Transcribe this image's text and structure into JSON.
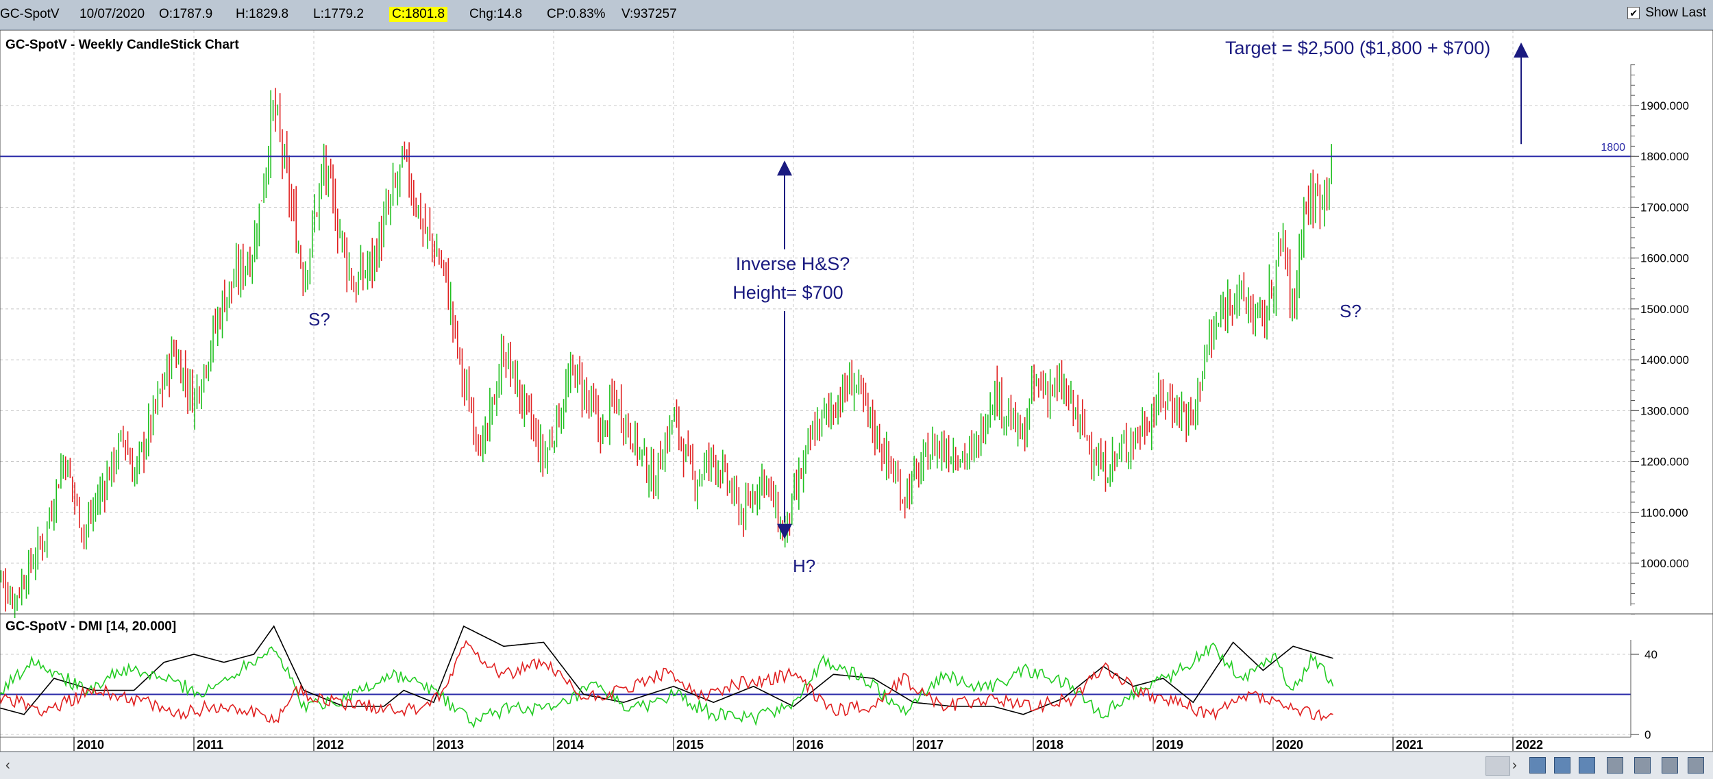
{
  "toolbar": {
    "symbol": "GC-SpotV",
    "date": "10/07/2020",
    "open": "O:1787.9",
    "high": "H:1829.8",
    "low": "L:1779.2",
    "close": "C:1801.8",
    "change": "Chg:14.8",
    "change_pct": "CP:0.83%",
    "volume": "V:937257",
    "show_last_label": "Show Last",
    "show_last_checked": "✔"
  },
  "colors": {
    "up": "#20c020",
    "down": "#e02020",
    "annotation": "#1a1a80",
    "grid": "#c8c8c8",
    "adx": "#000000",
    "plus_di": "#22cc22",
    "minus_di": "#e02020",
    "threshold": "#2a2aa8"
  },
  "chart_data": [
    {
      "type": "candlestick",
      "title": "GC-SpotV - Weekly CandleStick Chart",
      "frequency": "weekly",
      "x_range": [
        "2009-05",
        "2022-09"
      ],
      "ylim": [
        900,
        2000
      ],
      "y_ticks": [
        "1000.000",
        "1100.000",
        "1200.000",
        "1300.000",
        "1400.000",
        "1500.000",
        "1600.000",
        "1700.000",
        "1800.000",
        "1900.000"
      ],
      "x_ticks": [
        "2010",
        "2011",
        "2012",
        "2013",
        "2014",
        "2015",
        "2016",
        "2017",
        "2018",
        "2019",
        "2020",
        "2021",
        "2022"
      ],
      "grid": true,
      "price_path": [
        {
          "date": "2009-05",
          "close": 980
        },
        {
          "date": "2009-07",
          "close": 930
        },
        {
          "date": "2009-10",
          "close": 1050
        },
        {
          "date": "2009-12",
          "close": 1210
        },
        {
          "date": "2010-02",
          "close": 1060
        },
        {
          "date": "2010-06",
          "close": 1250
        },
        {
          "date": "2010-07",
          "close": 1170
        },
        {
          "date": "2010-11",
          "close": 1420
        },
        {
          "date": "2011-01",
          "close": 1320
        },
        {
          "date": "2011-04",
          "close": 1520
        },
        {
          "date": "2011-07",
          "close": 1620
        },
        {
          "date": "2011-09",
          "close": 1900
        },
        {
          "date": "2011-12",
          "close": 1560
        },
        {
          "date": "2012-02",
          "close": 1780
        },
        {
          "date": "2012-05",
          "close": 1540
        },
        {
          "date": "2012-07",
          "close": 1600
        },
        {
          "date": "2012-10",
          "close": 1790
        },
        {
          "date": "2012-12",
          "close": 1660
        },
        {
          "date": "2013-02",
          "close": 1580
        },
        {
          "date": "2013-04",
          "close": 1350
        },
        {
          "date": "2013-06",
          "close": 1220
        },
        {
          "date": "2013-08",
          "close": 1420
        },
        {
          "date": "2013-12",
          "close": 1200
        },
        {
          "date": "2014-03",
          "close": 1380
        },
        {
          "date": "2014-06",
          "close": 1250
        },
        {
          "date": "2014-07",
          "close": 1330
        },
        {
          "date": "2014-11",
          "close": 1160
        },
        {
          "date": "2015-01",
          "close": 1290
        },
        {
          "date": "2015-03",
          "close": 1160
        },
        {
          "date": "2015-05",
          "close": 1210
        },
        {
          "date": "2015-08",
          "close": 1090
        },
        {
          "date": "2015-10",
          "close": 1180
        },
        {
          "date": "2015-12",
          "close": 1050
        },
        {
          "date": "2016-03",
          "close": 1260
        },
        {
          "date": "2016-07",
          "close": 1360
        },
        {
          "date": "2016-12",
          "close": 1130
        },
        {
          "date": "2017-03",
          "close": 1230
        },
        {
          "date": "2017-07",
          "close": 1210
        },
        {
          "date": "2017-09",
          "close": 1340
        },
        {
          "date": "2017-12",
          "close": 1240
        },
        {
          "date": "2018-01",
          "close": 1350
        },
        {
          "date": "2018-04",
          "close": 1340
        },
        {
          "date": "2018-08",
          "close": 1180
        },
        {
          "date": "2018-12",
          "close": 1270
        },
        {
          "date": "2019-02",
          "close": 1330
        },
        {
          "date": "2019-05",
          "close": 1280
        },
        {
          "date": "2019-06",
          "close": 1400
        },
        {
          "date": "2019-09",
          "close": 1540
        },
        {
          "date": "2019-12",
          "close": 1470
        },
        {
          "date": "2020-02",
          "close": 1640
        },
        {
          "date": "2020-03",
          "close": 1480
        },
        {
          "date": "2020-04",
          "close": 1700
        },
        {
          "date": "2020-06",
          "close": 1730
        },
        {
          "date": "2020-07",
          "close": 1801.8
        }
      ],
      "resistance": {
        "value": 1800,
        "label": "1800"
      },
      "annotations": {
        "target": "Target = $2,500 ($1,800 + $700)",
        "pattern": "Inverse H&S?",
        "height": "Height= $700",
        "left_shoulder": "S?",
        "head": "H?",
        "right_shoulder": "S?"
      }
    },
    {
      "type": "line",
      "title": "GC-SpotV - DMI [14, 20.000]",
      "ylim": [
        0,
        55
      ],
      "y_ticks": [
        "0",
        "40"
      ],
      "threshold": 20,
      "series": [
        {
          "key": "adx",
          "points": [
            [
              "2009-05",
              14
            ],
            [
              "2009-08",
              10
            ],
            [
              "2009-11",
              28
            ],
            [
              "2010-03",
              22
            ],
            [
              "2010-07",
              22
            ],
            [
              "2010-10",
              36
            ],
            [
              "2011-01",
              40
            ],
            [
              "2011-04",
              36
            ],
            [
              "2011-07",
              40
            ],
            [
              "2011-09",
              54
            ],
            [
              "2011-12",
              22
            ],
            [
              "2012-04",
              14
            ],
            [
              "2012-08",
              14
            ],
            [
              "2012-10",
              22
            ],
            [
              "2013-01",
              16
            ],
            [
              "2013-04",
              54
            ],
            [
              "2013-08",
              44
            ],
            [
              "2013-12",
              46
            ],
            [
              "2014-04",
              20
            ],
            [
              "2014-08",
              16
            ],
            [
              "2015-01",
              24
            ],
            [
              "2015-05",
              16
            ],
            [
              "2015-09",
              24
            ],
            [
              "2016-01",
              14
            ],
            [
              "2016-05",
              30
            ],
            [
              "2016-09",
              28
            ],
            [
              "2017-01",
              16
            ],
            [
              "2017-05",
              14
            ],
            [
              "2017-09",
              14
            ],
            [
              "2017-12",
              10
            ],
            [
              "2018-04",
              18
            ],
            [
              "2018-08",
              34
            ],
            [
              "2018-11",
              24
            ],
            [
              "2019-02",
              28
            ],
            [
              "2019-05",
              16
            ],
            [
              "2019-09",
              46
            ],
            [
              "2019-12",
              32
            ],
            [
              "2020-03",
              44
            ],
            [
              "2020-07",
              38
            ]
          ]
        },
        {
          "key": "plus_di",
          "points": [
            [
              "2009-05",
              18
            ],
            [
              "2009-09",
              38
            ],
            [
              "2010-02",
              22
            ],
            [
              "2010-06",
              32
            ],
            [
              "2010-10",
              28
            ],
            [
              "2011-02",
              20
            ],
            [
              "2011-06",
              34
            ],
            [
              "2011-09",
              44
            ],
            [
              "2011-12",
              14
            ],
            [
              "2012-04",
              18
            ],
            [
              "2012-09",
              30
            ],
            [
              "2013-01",
              22
            ],
            [
              "2013-05",
              6
            ],
            [
              "2013-09",
              14
            ],
            [
              "2014-01",
              12
            ],
            [
              "2014-05",
              24
            ],
            [
              "2014-09",
              12
            ],
            [
              "2015-01",
              20
            ],
            [
              "2015-05",
              10
            ],
            [
              "2015-09",
              8
            ],
            [
              "2016-01",
              16
            ],
            [
              "2016-04",
              36
            ],
            [
              "2016-08",
              28
            ],
            [
              "2016-12",
              12
            ],
            [
              "2017-04",
              30
            ],
            [
              "2017-08",
              22
            ],
            [
              "2017-12",
              32
            ],
            [
              "2018-04",
              26
            ],
            [
              "2018-08",
              10
            ],
            [
              "2018-12",
              24
            ],
            [
              "2019-03",
              30
            ],
            [
              "2019-07",
              44
            ],
            [
              "2019-10",
              28
            ],
            [
              "2020-01",
              40
            ],
            [
              "2020-03",
              22
            ],
            [
              "2020-05",
              40
            ],
            [
              "2020-07",
              24
            ]
          ]
        },
        {
          "key": "minus_di",
          "points": [
            [
              "2009-05",
              20
            ],
            [
              "2009-10",
              12
            ],
            [
              "2010-03",
              22
            ],
            [
              "2010-07",
              18
            ],
            [
              "2010-11",
              10
            ],
            [
              "2011-03",
              14
            ],
            [
              "2011-07",
              12
            ],
            [
              "2011-09",
              6
            ],
            [
              "2011-11",
              22
            ],
            [
              "2012-03",
              16
            ],
            [
              "2012-07",
              14
            ],
            [
              "2012-11",
              12
            ],
            [
              "2013-02",
              20
            ],
            [
              "2013-04",
              46
            ],
            [
              "2013-08",
              30
            ],
            [
              "2013-12",
              36
            ],
            [
              "2014-04",
              18
            ],
            [
              "2014-08",
              22
            ],
            [
              "2014-12",
              30
            ],
            [
              "2015-04",
              20
            ],
            [
              "2015-08",
              26
            ],
            [
              "2016-01",
              30
            ],
            [
              "2016-05",
              12
            ],
            [
              "2016-09",
              14
            ],
            [
              "2016-12",
              28
            ],
            [
              "2017-04",
              14
            ],
            [
              "2017-08",
              18
            ],
            [
              "2018-01",
              14
            ],
            [
              "2018-05",
              18
            ],
            [
              "2018-08",
              34
            ],
            [
              "2018-12",
              20
            ],
            [
              "2019-03",
              16
            ],
            [
              "2019-07",
              10
            ],
            [
              "2019-11",
              20
            ],
            [
              "2020-03",
              12
            ],
            [
              "2020-07",
              10
            ]
          ]
        }
      ]
    }
  ],
  "scrollbar": {
    "left_arrow": "‹",
    "right_arrow": "›"
  }
}
